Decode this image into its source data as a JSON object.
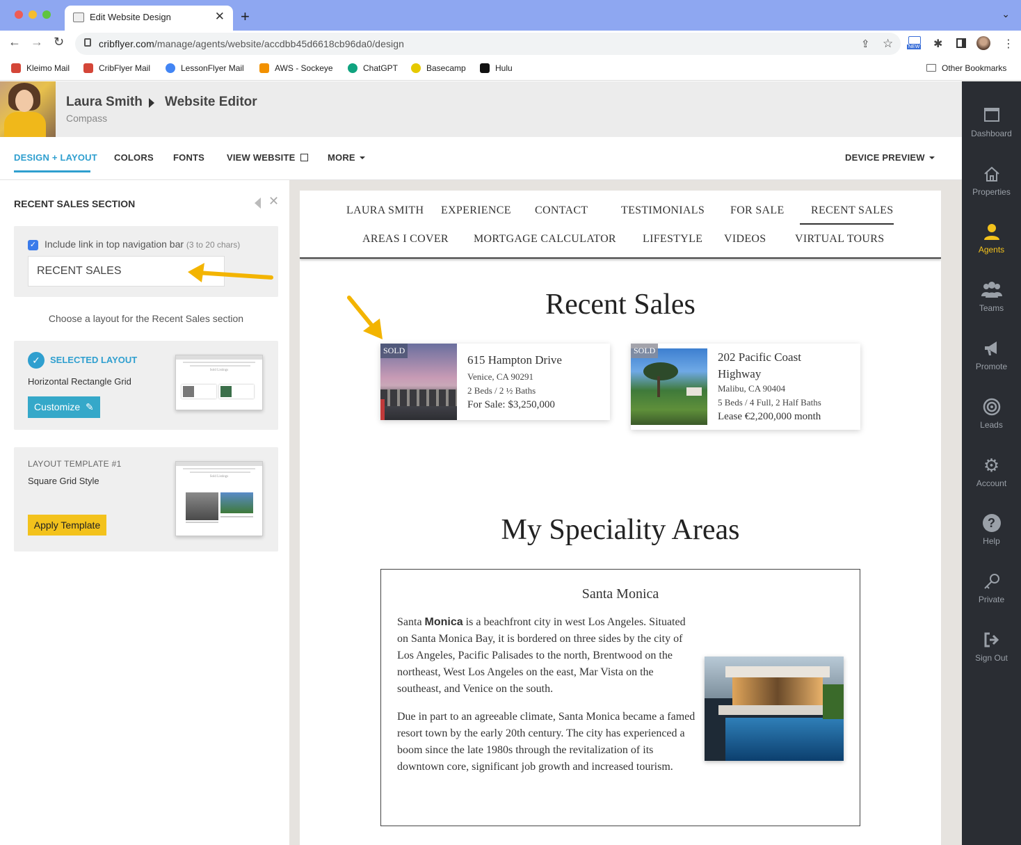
{
  "browser": {
    "tab_title": "Edit Website Design",
    "url_host": "cribflyer.com",
    "url_path": "/manage/agents/website/accdbb45d6618cb96da0/design",
    "new_badge": "NEW",
    "bookmarks": [
      {
        "label": "Kleimo Mail",
        "color": "#d44638"
      },
      {
        "label": "CribFlyer Mail",
        "color": "#d44638"
      },
      {
        "label": "LessonFlyer Mail",
        "color": "#4285f4"
      },
      {
        "label": "AWS - Sockeye",
        "color": "#f29100"
      },
      {
        "label": "ChatGPT",
        "color": "#10a37f"
      },
      {
        "label": "Basecamp",
        "color": "#e6c900"
      },
      {
        "label": "Hulu",
        "color": "#111111"
      }
    ],
    "other_bookmarks": "Other Bookmarks"
  },
  "header": {
    "agent_name": "Laura Smith",
    "page": "Website Editor",
    "company": "Compass"
  },
  "editor_tabs": {
    "design_layout": "DESIGN + LAYOUT",
    "colors": "COLORS",
    "fonts": "FONTS",
    "view_website": "VIEW WEBSITE",
    "more": "MORE",
    "device_preview": "DEVICE PREVIEW"
  },
  "panel": {
    "title": "RECENT SALES SECTION",
    "nav_checkbox_label": "Include link in top navigation bar",
    "nav_checkbox_hint": "(3 to 20 chars)",
    "nav_input_value": "RECENT SALES",
    "layout_prompt": "Choose a layout for the Recent Sales section",
    "selected": {
      "label": "SELECTED LAYOUT",
      "name": "Horizontal Rectangle Grid",
      "button": "Customize"
    },
    "template": {
      "label": "LAYOUT TEMPLATE #1",
      "name": "Square Grid Style",
      "button": "Apply Template"
    },
    "thumb_title": "Sold Listings"
  },
  "site_nav": {
    "row1": [
      "LAURA SMITH",
      "EXPERIENCE",
      "CONTACT",
      "TESTIMONIALS",
      "FOR SALE",
      "RECENT SALES"
    ],
    "row2": [
      "AREAS I COVER",
      "MORTGAGE CALCULATOR",
      "LIFESTYLE",
      "VIDEOS",
      "VIRTUAL TOURS"
    ]
  },
  "recent_sales": {
    "title": "Recent Sales",
    "listings": [
      {
        "badge": "SOLD",
        "address": "615 Hampton Drive",
        "city": "Venice, CA 90291",
        "beds_baths": "2 Beds / 2 ½ Baths",
        "price": "For Sale: $3,250,000"
      },
      {
        "badge": "SOLD",
        "address_line1": "202 Pacific Coast",
        "address_line2": "Highway",
        "city": "Malibu, CA 90404",
        "beds_baths": "5 Beds / 4 Full, 2 Half Baths",
        "price": "Lease €2,200,000 month"
      }
    ]
  },
  "speciality": {
    "title": "My Speciality Areas",
    "area_name": "Santa Monica",
    "p1_pre": "Santa ",
    "p1_bold": "Monica",
    "p1_post": " is a beachfront city in west Los Angeles. Situated on Santa Monica Bay, it is bordered on three sides by the city of Los Angeles, Pacific Palisades to the north, Brentwood on the northeast, West Los Angeles on the east, Mar Vista on the southeast, and Venice on the south.",
    "p2": "Due in part to an agreeable climate, Santa Monica became a famed resort town by the early 20th century. The city has experienced a boom since the late 1980s through the revitalization of its downtown core, significant job growth and increased tourism."
  },
  "sidebar": {
    "items": [
      {
        "label": "Dashboard",
        "icon": "dashboard-icon"
      },
      {
        "label": "Properties",
        "icon": "home-icon"
      },
      {
        "label": "Agents",
        "icon": "person-icon"
      },
      {
        "label": "Teams",
        "icon": "team-icon"
      },
      {
        "label": "Promote",
        "icon": "megaphone-icon"
      },
      {
        "label": "Leads",
        "icon": "target-icon"
      },
      {
        "label": "Account",
        "icon": "gear-icon"
      },
      {
        "label": "Help",
        "icon": "question-icon"
      },
      {
        "label": "Private",
        "icon": "key-icon"
      },
      {
        "label": "Sign Out",
        "icon": "signout-icon"
      }
    ],
    "active": "Agents"
  },
  "colors": {
    "accent": "#2f9fcf",
    "apply_button": "#f3c21c",
    "sidebar_bg": "#2a2d33",
    "annotation_arrow": "#f3b400"
  }
}
